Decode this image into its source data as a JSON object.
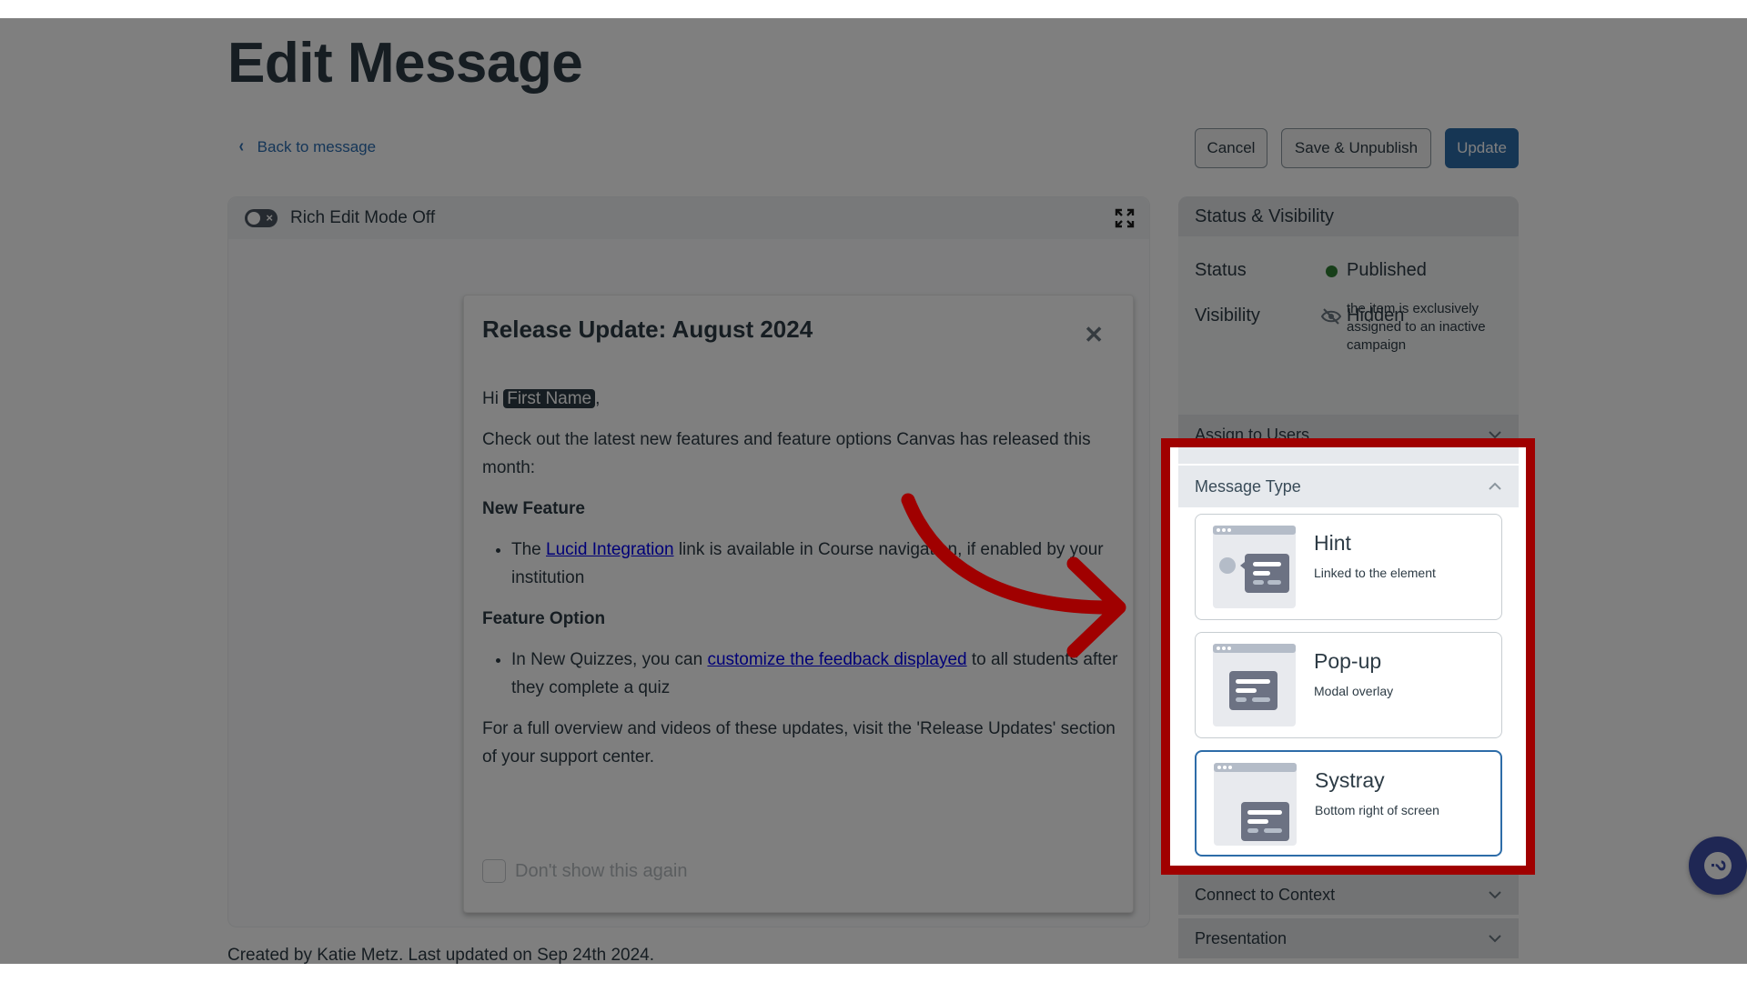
{
  "header": {
    "title": "Edit Message",
    "back_link": "Back to message"
  },
  "toolbar": {
    "cancel_label": "Cancel",
    "save_unpublish_label": "Save & Unpublish",
    "update_label": "Update"
  },
  "editor": {
    "rich_edit_label": "Rich Edit Mode Off",
    "message": {
      "title": "Release Update: August 2024",
      "greeting_prefix": "Hi",
      "greeting_token": "First Name",
      "greeting_suffix": ",",
      "intro": "Check out the latest new features and feature options Canvas has released this month:",
      "section1_heading": "New Feature",
      "section1_item_prefix": "The",
      "section1_item_link": "Lucid Integration",
      "section1_item_suffix": "link is available in Course navigation, if enabled by your institution",
      "section2_heading": "Feature Option",
      "section2_item_prefix": "In New Quizzes, you can",
      "section2_item_link": "customize the feedback displayed",
      "section2_item_suffix": "to all students after they complete a quiz",
      "closing": "For a full overview and videos of these updates, visit the 'Release Updates' section of your support center.",
      "dont_show_label": "Don't show this again"
    }
  },
  "footer_note": "Created by Katie Metz. Last updated on Sep 24th 2024.",
  "sidebar": {
    "status_visibility": {
      "title": "Status & Visibility",
      "status_label": "Status",
      "status_value": "Published",
      "status_color": "#2e7d32",
      "visibility_label": "Visibility",
      "visibility_value": "Hidden",
      "visibility_desc": "the item is exclusively assigned to an inactive campaign"
    },
    "assign_to_users": "Assign to Users",
    "message_type": {
      "title": "Message Type",
      "options": [
        {
          "title": "Hint",
          "desc": "Linked to the element",
          "selected": false
        },
        {
          "title": "Pop-up",
          "desc": "Modal overlay",
          "selected": false
        },
        {
          "title": "Systray",
          "desc": "Bottom right of screen",
          "selected": true
        }
      ]
    },
    "connect_to_context": "Connect to Context",
    "presentation": "Presentation"
  },
  "colors": {
    "primary": "#2d6ca8",
    "highlight_box": "#a00000",
    "help_button": "#3f4fa8"
  }
}
